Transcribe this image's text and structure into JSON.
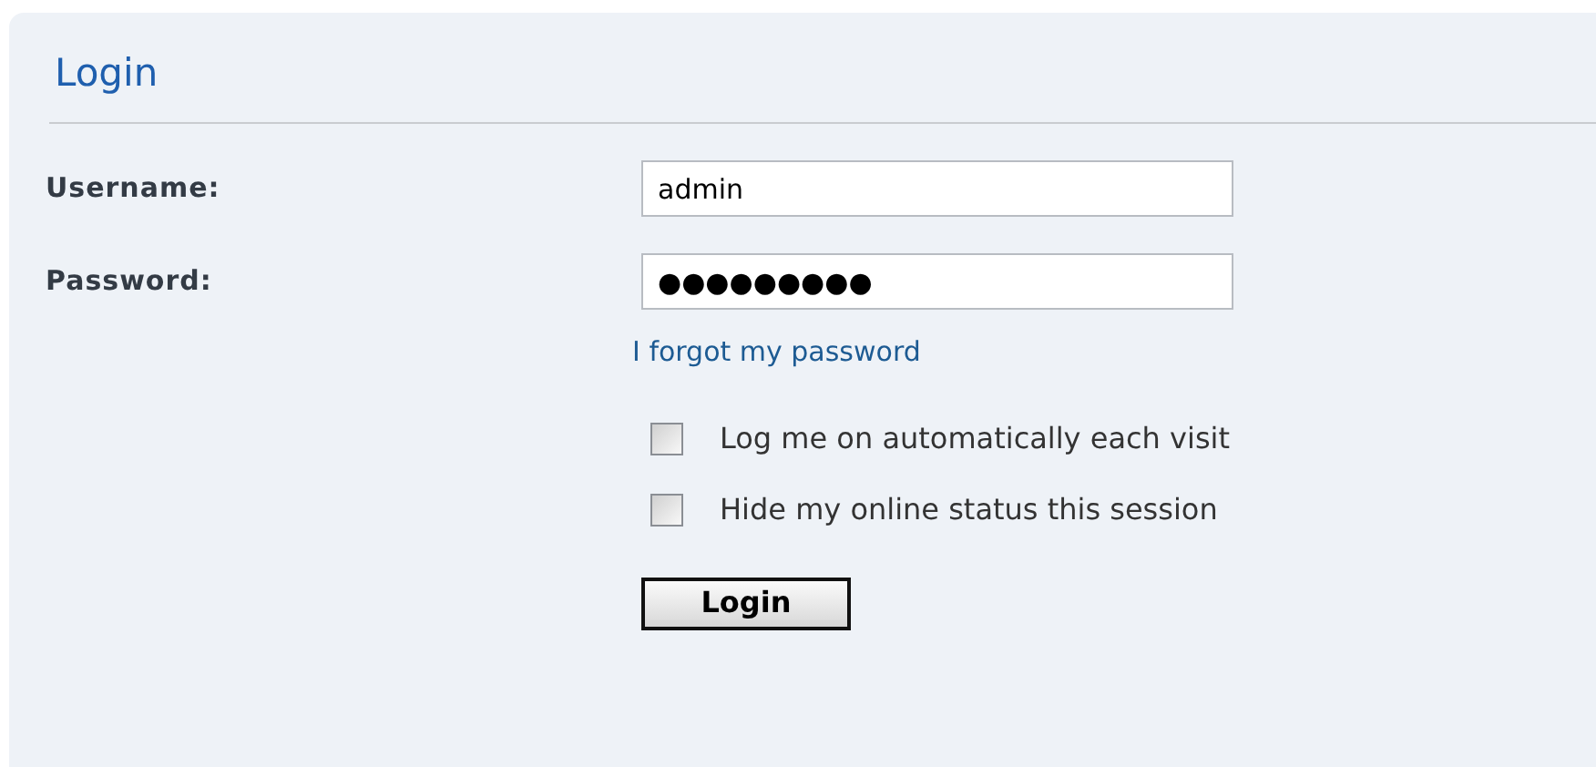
{
  "panel": {
    "title": "Login"
  },
  "fields": [
    {
      "label": "Username:",
      "value": "admin"
    },
    {
      "label": "Password:",
      "value": "●●●●●●●●●"
    }
  ],
  "forgot_link": "I forgot my password",
  "options": [
    {
      "label": "Log me on automatically each visit",
      "checked": false
    },
    {
      "label": "Hide my online status this session",
      "checked": false
    }
  ],
  "submit": "Login"
}
